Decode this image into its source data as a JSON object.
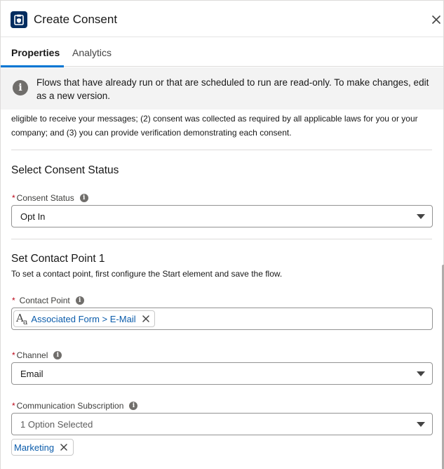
{
  "header": {
    "title": "Create Consent",
    "icon": "consent-shield-icon",
    "icon_color": "#032d60"
  },
  "tabs": [
    {
      "label": "Properties",
      "active": true
    },
    {
      "label": "Analytics",
      "active": false
    }
  ],
  "banner": {
    "text": "Flows that have already run or that are scheduled to run are read-only. To make changes, edit as a new version."
  },
  "intro": {
    "text": "eligible to receive your messages; (2) consent was collected as required by all applicable laws for you or your company; and (3) you can provide verification demonstrating each consent."
  },
  "consent_status": {
    "section_title": "Select Consent Status",
    "label": "Consent Status",
    "required_mark": "*",
    "value": "Opt In"
  },
  "contact_point": {
    "section_title": "Set Contact Point 1",
    "subtitle": "To set a contact point, first configure the Start element and save the flow.",
    "label": "Contact Point",
    "required_mark": "*",
    "pill_label": "Associated Form > E-Mail",
    "type_icon_text": "A",
    "type_icon_sub": "a"
  },
  "channel": {
    "label": "Channel",
    "required_mark": "*",
    "value": "Email"
  },
  "subscription": {
    "label": "Communication Subscription",
    "required_mark": "*",
    "value": "1 Option Selected",
    "selected_pill": "Marketing"
  },
  "colors": {
    "accent": "#0176d3",
    "link": "#0b5cab",
    "required": "#ba0517"
  }
}
